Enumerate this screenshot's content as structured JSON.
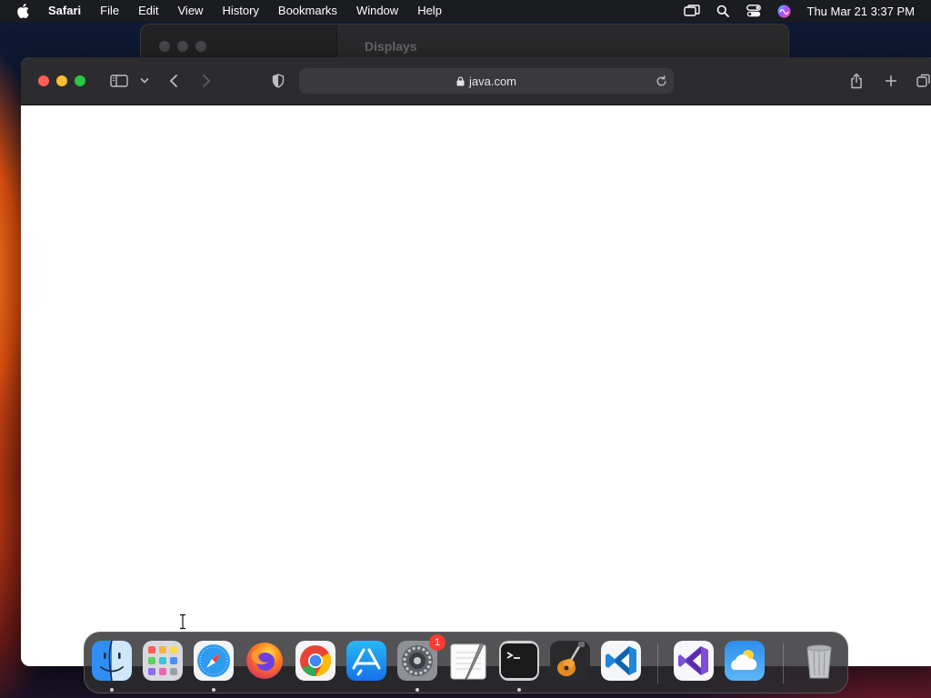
{
  "menubar": {
    "app_name": "Safari",
    "menus": [
      "File",
      "Edit",
      "View",
      "History",
      "Bookmarks",
      "Window",
      "Help"
    ],
    "clock": "Thu Mar 21  3:37 PM"
  },
  "background_window": {
    "title": "Displays"
  },
  "safari": {
    "url": "java.com"
  },
  "dock": {
    "apps": [
      {
        "name": "finder-icon",
        "running": true
      },
      {
        "name": "launchpad-icon",
        "running": false
      },
      {
        "name": "safari-icon",
        "running": true
      },
      {
        "name": "firefox-icon",
        "running": false
      },
      {
        "name": "chrome-icon",
        "running": false
      },
      {
        "name": "app-store-icon",
        "running": false
      },
      {
        "name": "system-settings-icon",
        "running": true,
        "badge": "1"
      },
      {
        "name": "textedit-icon",
        "running": false
      },
      {
        "name": "terminal-icon",
        "running": true
      },
      {
        "name": "garageband-icon",
        "running": false
      },
      {
        "name": "vscode-icon",
        "running": false
      },
      {
        "name": "visual-studio-icon",
        "running": false
      },
      {
        "name": "weather-icon",
        "running": false
      },
      {
        "name": "trash-icon",
        "running": false
      }
    ]
  }
}
